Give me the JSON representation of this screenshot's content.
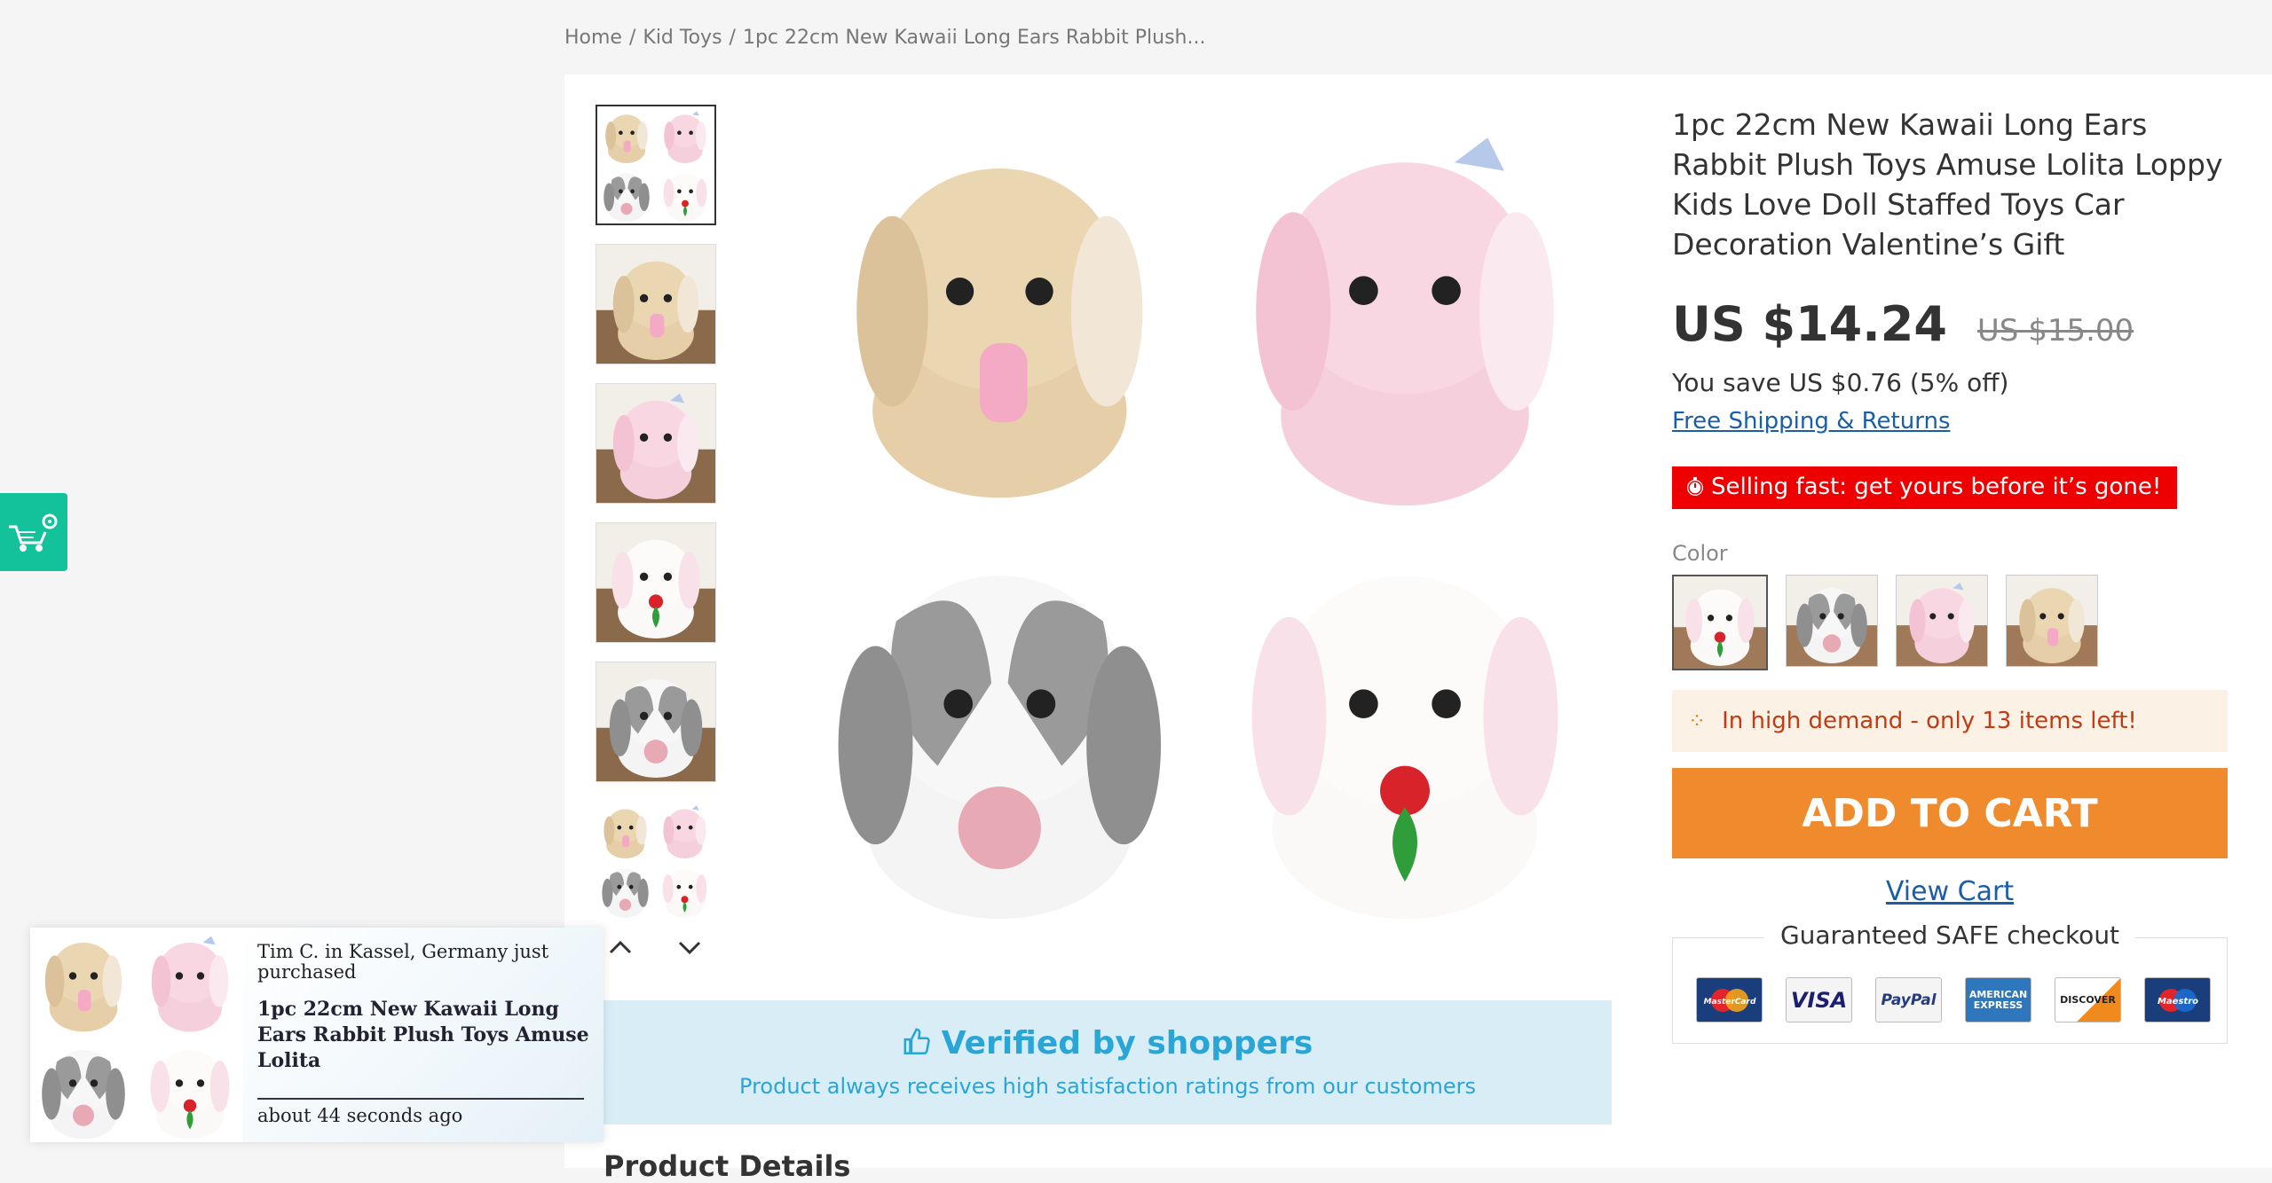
{
  "breadcrumb": {
    "home": "Home",
    "category": "Kid Toys",
    "current": "1pc 22cm New Kawaii Long Ears Rabbit Plush...",
    "separator": "/"
  },
  "gallery": {
    "thumb_count": 6,
    "prev_icon": "chevron-up-icon",
    "next_icon": "chevron-down-icon"
  },
  "verified": {
    "title": "Verified by shoppers",
    "subtitle": "Product always receives high satisfaction ratings from our customers"
  },
  "product_details_label": "Product Details",
  "product": {
    "title": "1pc 22cm New Kawaii Long Ears Rabbit Plush Toys Amuse Lolita Loppy Kids Love Doll Staffed Toys Car Decoration Valentine’s Gift",
    "price": "US $14.24",
    "old_price": "US $15.00",
    "savings": "You save US $0.76 (5% off)",
    "shipping_link": "Free Shipping & Returns",
    "urgency": "Selling fast: get yours before it’s gone!",
    "color_label": "Color",
    "colors": [
      "white",
      "grey",
      "pink",
      "beige"
    ],
    "demand": "In high demand - only 13 items left!",
    "add_to_cart": "ADD TO CART",
    "view_cart": "View Cart",
    "safe_checkout": "Guaranteed SAFE checkout",
    "payment_cards": [
      "MasterCard",
      "VISA",
      "PayPal",
      "AMERICAN EXPRESS",
      "DISCOVER",
      "Maestro"
    ]
  },
  "popup": {
    "who": "Tim C. in Kassel, Germany just purchased",
    "product": "1pc 22cm New Kawaii Long Ears Rabbit Plush Toys Amuse Lolita",
    "time": "about 44 seconds ago"
  },
  "colors": {
    "accent_orange": "#ef8b2c",
    "urgency_red": "#ee0000",
    "verified_blue": "#29a6d6",
    "link_blue": "#1a5ea8",
    "side_tool_green": "#13c29a"
  }
}
